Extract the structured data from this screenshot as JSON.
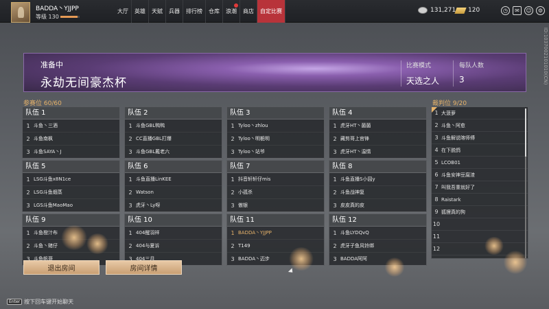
{
  "player": {
    "name": "BADDA丶YJJPP",
    "level": "等级 130",
    "exp_fraction": 0.9
  },
  "nav": [
    {
      "label": "大厅"
    },
    {
      "label": "英雄"
    },
    {
      "label": "天赋"
    },
    {
      "label": "兵器"
    },
    {
      "label": "排行榜"
    },
    {
      "label": "仓库"
    },
    {
      "label": "浪潮"
    },
    {
      "label": "商店"
    },
    {
      "label": "自定比赛",
      "active": true
    }
  ],
  "currency": {
    "silver": "131,271",
    "gold": "120"
  },
  "side_id": "ID:1037002101010(CN)",
  "banner": {
    "status": "准备中",
    "title": "永劫无间豪杰杯",
    "mode_label": "比赛模式",
    "mode_value": "天选之人",
    "team_size_label": "每队人数",
    "team_size_value": "3"
  },
  "participants_label": "参赛位  60/60",
  "referee_label": "裁判位  9/20",
  "teams": [
    {
      "name": "队伍 1",
      "members": [
        "斗鱼丶三酒",
        "斗鱼南枫",
        "斗鱼SAYA丶J"
      ]
    },
    {
      "name": "队伍 2",
      "members": [
        "斗鱼GBL鸭鸭",
        "CC直播GBL打爆",
        "斗鱼GBL戴老六"
      ]
    },
    {
      "name": "队伍 3",
      "members": [
        "Tyloo丶zhlou",
        "Tyloo丶明栀明",
        "Tyloo丶站爷"
      ]
    },
    {
      "name": "队伍 4",
      "members": [
        "虎牙HT丶菌菌",
        "藏剪哥上官锋",
        "虎牙HT丶温情"
      ]
    },
    {
      "name": "队伍 5",
      "members": [
        "LSG斗鱼x8N1ce",
        "LSG斗鱼烟蒸",
        "LGS斗鱼MaoMao"
      ]
    },
    {
      "name": "队伍 6",
      "members": [
        "斗鱼直播LinKEE",
        "Watson",
        "虎牙丶Ly呀"
      ]
    },
    {
      "name": "队伍 7",
      "members": [
        "抖音轩轩仔mis",
        "小孤杀",
        "傲银"
      ]
    },
    {
      "name": "队伍 8",
      "members": [
        "斗鱼直播S小园y",
        "斗鱼战神复",
        "皮皮真的皮"
      ]
    },
    {
      "name": "队伍 9",
      "members": [
        "斗鱼橙汁布",
        "斗鱼丶赌仔",
        "斗鱼帆哥"
      ]
    },
    {
      "name": "队伍 10",
      "members": [
        "404醒羽祥",
        "404与夏诉",
        "404三月"
      ]
    },
    {
      "name": "队伍 11",
      "members": [
        "BADDA丶YJJPP",
        "T149",
        "BADDA丶迈步"
      ],
      "me_index": 0
    },
    {
      "name": "队伍 12",
      "members": [
        "斗鱼LYDQvQ",
        "虎牙子鱼风铃绑",
        "BADDA阿阿"
      ]
    }
  ],
  "referees": [
    {
      "num": "1",
      "name": "大菠萝"
    },
    {
      "num": "2",
      "name": "斗鱼丶阿愈"
    },
    {
      "num": "3",
      "name": "斗鱼解说喀师傅"
    },
    {
      "num": "4",
      "name": "在下脱鸽"
    },
    {
      "num": "5",
      "name": "LCOB01"
    },
    {
      "num": "6",
      "name": "斗鱼安神豆腐渣"
    },
    {
      "num": "7",
      "name": "叫我吾重就好了"
    },
    {
      "num": "8",
      "name": "Raistark"
    },
    {
      "num": "9",
      "name": "狐狸真的狗"
    },
    {
      "num": "10",
      "name": ""
    },
    {
      "num": "11",
      "name": ""
    },
    {
      "num": "12",
      "name": ""
    }
  ],
  "buttons": {
    "exit": "退出房间",
    "details": "房间详情"
  },
  "chat_hint": {
    "key": "Enter",
    "text": "按下回车键开始聊天"
  }
}
